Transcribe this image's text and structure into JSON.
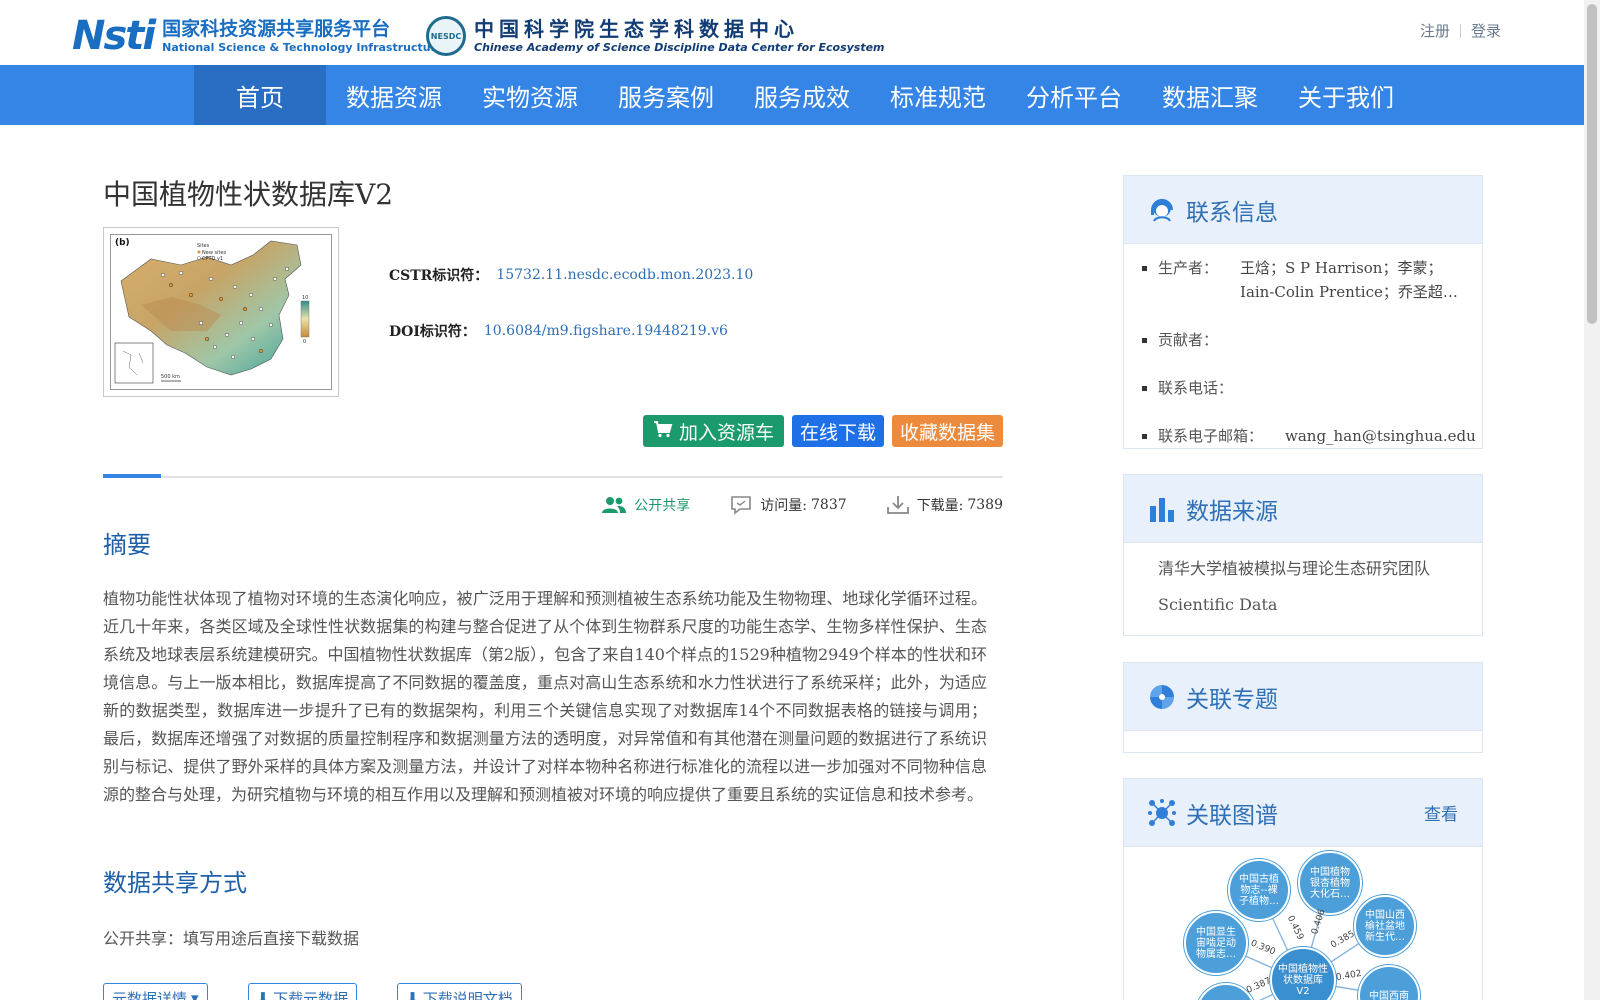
{
  "header": {
    "logo1": {
      "mark": "Nsti",
      "cn": "国家科技资源共享服务平台",
      "en": "National Science & Technology Infrastructure"
    },
    "logo2": {
      "mark": "NESDC",
      "cn": "中国科学院生态学科数据中心",
      "en": "Chinese Academy of Science Discipline Data Center for Ecosystem"
    },
    "register": "注册",
    "login": "登录"
  },
  "nav": {
    "items": [
      "首页",
      "数据资源",
      "实物资源",
      "服务案例",
      "服务成效",
      "标准规范",
      "分析平台",
      "数据汇聚",
      "关于我们"
    ],
    "active_index": 0
  },
  "dataset": {
    "title": "中国植物性状数据库V2",
    "cstr_label": "CSTR标识符：",
    "cstr_value": "15732.11.nesdc.ecodb.mon.2023.10",
    "doi_label": "DOI标识符：",
    "doi_value": "10.6084/m9.figshare.19448219.v6",
    "thumb": {
      "panel_label": "(b)",
      "legend_title": "Sites",
      "legend_new": "New sites",
      "legend_old": "CPTD v1",
      "scale_max": "10",
      "scale_min": "0",
      "scale_bar": "500 km"
    }
  },
  "actions": {
    "add_cart": "加入资源车",
    "download": "在线下载",
    "favorite": "收藏数据集"
  },
  "stats": {
    "share": "公开共享",
    "visits_label": "访问量:",
    "visits": "7837",
    "downloads_label": "下载量:",
    "downloads": "7389"
  },
  "abstract": {
    "title": "摘要",
    "text": "植物功能性状体现了植物对环境的生态演化响应，被广泛用于理解和预测植被生态系统功能及生物物理、地球化学循环过程。近几十年来，各类区域及全球性性状数据集的构建与整合促进了从个体到生物群系尺度的功能生态学、生物多样性保护、生态系统及地球表层系统建模研究。中国植物性状数据库（第2版），包含了来自140个样点的1529种植物2949个样本的性状和环境信息。与上一版本相比，数据库提高了不同数据的覆盖度，重点对高山生态系统和水力性状进行了系统采样；此外，为适应新的数据类型，数据库进一步提升了已有的数据架构，利用三个关键信息实现了对数据库14个不同数据表格的链接与调用；最后，数据库还增强了对数据的质量控制程序和数据测量方法的透明度，对异常值和有其他潜在测量问题的数据进行了系统识别与标记、提供了野外采样的具体方案及测量方法，并设计了对样本物种名称进行标准化的流程以进一步加强对不同物种信息源的整合与处理，为研究植物与环境的相互作用以及理解和预测植被对环境的响应提供了重要且系统的实证信息和技术参考。"
  },
  "sharing": {
    "title": "数据共享方式",
    "text": "公开共享：填写用途后直接下载数据",
    "meta_btn": "元数据详情",
    "meta_download": "下载元数据",
    "doc_download": "下载说明文档"
  },
  "contact": {
    "title": "联系信息",
    "producer_label": "生产者：",
    "producer": "王焓；S P Harrison；李蒙；Iain-Colin Prentice；乔圣超…",
    "contributor_label": "贡献者：",
    "contributor": "",
    "phone_label": "联系电话：",
    "phone": "",
    "email_label": "联系电子邮箱：",
    "email": "wang_han@tsinghua.edu"
  },
  "source": {
    "title": "数据来源",
    "items": [
      "清华大学植被模拟与理论生态研究团队",
      "Scientific Data"
    ]
  },
  "topics": {
    "title": "关联专题"
  },
  "graph": {
    "title": "关联图谱",
    "view": "查看",
    "nodes": [
      {
        "label": "中国古植物志--裸子植物…"
      },
      {
        "label": "中国植物银杏植物大化石…"
      },
      {
        "label": "中国山西榆社盆地新生代…"
      },
      {
        "label": "中国显生宙啮足动物属志…"
      },
      {
        "label": "中国植物性状数据库V2"
      },
      {
        "label": "中国西南"
      }
    ],
    "edges": [
      "0.459",
      "0.406",
      "0.385",
      "0.390",
      "0.402",
      "0.387"
    ]
  }
}
